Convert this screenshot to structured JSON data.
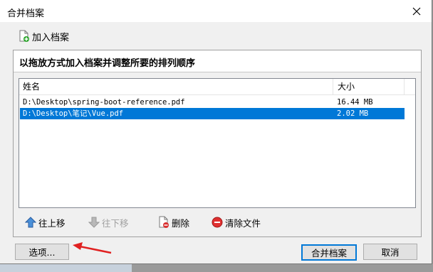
{
  "window": {
    "title": "合并档案"
  },
  "toolbar": {
    "add_label": "加入档案"
  },
  "panel": {
    "header": "以拖放方式加入档案并调整所要的排列顺序"
  },
  "table": {
    "columns": [
      "姓名",
      "大小"
    ],
    "rows": [
      {
        "path": "D:\\Desktop\\spring-boot-reference.pdf",
        "size": "16.44 MB",
        "selected": false
      },
      {
        "path": "D:\\Desktop\\笔记\\Vue.pdf",
        "size": "2.02 MB",
        "selected": true
      }
    ]
  },
  "actions": {
    "move_up": "往上移",
    "move_down": "往下移",
    "delete": "删除",
    "clear": "清除文件"
  },
  "footer": {
    "options": "选项...",
    "merge": "合并档案",
    "cancel": "取消"
  },
  "colors": {
    "selection": "#0078d7",
    "arrow": "#e02020"
  }
}
